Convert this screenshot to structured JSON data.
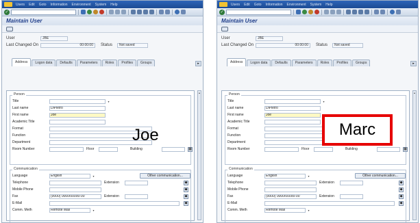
{
  "menu": [
    "Users",
    "Edit",
    "Goto",
    "Information",
    "Environment",
    "System",
    "Help"
  ],
  "window_title": "Maintain User",
  "header": {
    "user_label": "User",
    "user_value": "JBE",
    "last_changed_label": "Last Changed On",
    "time_value": "00:00:00",
    "status_label": "Status",
    "status_value": "Not saved"
  },
  "tabs": [
    "Address",
    "Logon data",
    "Defaults",
    "Parameters",
    "Roles",
    "Profiles",
    "Groups"
  ],
  "person": {
    "title": "Person",
    "fields": {
      "title": "Title",
      "last_name": "Last name",
      "first_name": "First name",
      "academic_title": "Academic Title",
      "format": "Format",
      "function": "Function",
      "department": "Department",
      "room_number": "Room Number",
      "floor": "Floor",
      "building": "Building"
    },
    "values": {
      "last_name": "DiPietro",
      "first_name": "Joe"
    }
  },
  "communication": {
    "title": "Communication",
    "fields": {
      "language": "Language",
      "telephone": "Telephone",
      "mobile_phone": "Mobile Phone",
      "fax": "Fax",
      "email": "E-Mail",
      "comm_meth": "Comm. Meth",
      "extension": "Extension"
    },
    "values": {
      "language": "English",
      "fax": "(9000) 0000/00000-00",
      "comm_meth": "Remote Mail"
    },
    "other_button": "Other communication..."
  },
  "overlays": {
    "left_name": "Joe",
    "right_name": "Marc"
  },
  "colors": {
    "sap_blue": "#1c4b93",
    "title_blue": "#22408c",
    "highlight_red": "#e60000",
    "focus_yellow": "#fff9c4"
  }
}
